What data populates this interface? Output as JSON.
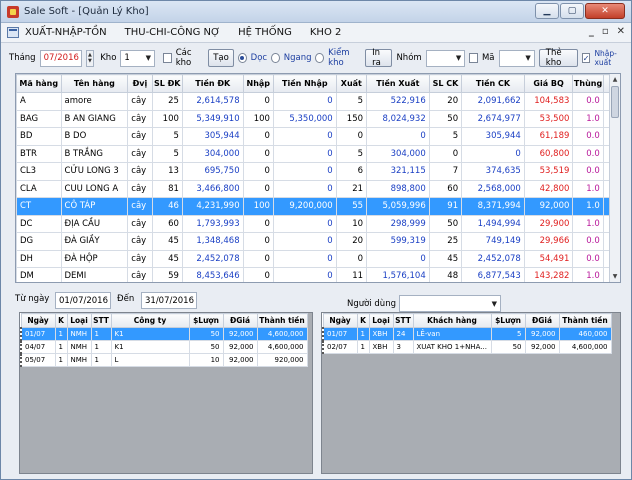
{
  "window": {
    "title": "Sale Soft - [Quản Lý Kho]"
  },
  "menu": [
    "XUẤT-NHẬP-TỒN",
    "THU-CHI-CÔNG NỢ",
    "HỆ THỐNG",
    "KHO 2"
  ],
  "toolbar": {
    "thang_label": "Tháng",
    "thang_value": "07/2016",
    "kho_label": "Kho",
    "kho_value": "1",
    "cac_kho_label": "Các kho",
    "tao_label": "Tạo",
    "doc_label": "Dọc",
    "ngang_label": "Ngang",
    "kiem_kho_label": "Kiểm kho",
    "in_ra_label": "In ra",
    "nhom_label": "Nhóm",
    "nhom_value": "",
    "ma_label": "Mã",
    "ma_value": "",
    "the_kho_label": "Thẻ kho",
    "nhap_xuat_label": "Nhập-xuất",
    "cac_kho_checked": false,
    "ma_checked": false,
    "nhap_xuat_checked": true,
    "view_mode": "Dọc"
  },
  "main_table": {
    "headers": [
      "Mã hàng",
      "Tên hàng",
      "Đvị",
      "SL ĐK",
      "Tiền ĐK",
      "Nhập",
      "Tiền Nhập",
      "Xuất",
      "Tiền Xuất",
      "SL CK",
      "Tiền CK",
      "Giá BQ",
      "Thùng"
    ],
    "selected_row": 6,
    "rows": [
      [
        "A",
        "amore",
        "cây",
        "25",
        "2,614,578",
        "0",
        "0",
        "5",
        "522,916",
        "20",
        "2,091,662",
        "104,583",
        "0.0"
      ],
      [
        "BAG",
        "B AN GIANG",
        "cây",
        "100",
        "5,349,910",
        "100",
        "5,350,000",
        "150",
        "8,024,932",
        "50",
        "2,674,977",
        "53,500",
        "1.0"
      ],
      [
        "BD",
        "B DO",
        "cây",
        "5",
        "305,944",
        "0",
        "0",
        "0",
        "0",
        "5",
        "305,944",
        "61,189",
        "0.0"
      ],
      [
        "BTR",
        "B TRẮNG",
        "cây",
        "5",
        "304,000",
        "0",
        "0",
        "5",
        "304,000",
        "0",
        "0",
        "60,800",
        "0.0"
      ],
      [
        "CL3",
        "CỬU LONG 3",
        "cây",
        "13",
        "695,750",
        "0",
        "0",
        "6",
        "321,115",
        "7",
        "374,635",
        "53,519",
        "0.0"
      ],
      [
        "CLA",
        "CUU LONG A",
        "cây",
        "81",
        "3,466,800",
        "0",
        "0",
        "21",
        "898,800",
        "60",
        "2,568,000",
        "42,800",
        "1.0"
      ],
      [
        "CT",
        "CÔ TÁP",
        "cây",
        "46",
        "4,231,990",
        "100",
        "9,200,000",
        "55",
        "5,059,996",
        "91",
        "8,371,994",
        "92,000",
        "1.0"
      ],
      [
        "DC",
        "ĐỊA CẦU",
        "cây",
        "60",
        "1,793,993",
        "0",
        "0",
        "10",
        "298,999",
        "50",
        "1,494,994",
        "29,900",
        "1.0"
      ],
      [
        "DG",
        "ĐÀ GIẦY",
        "cây",
        "45",
        "1,348,468",
        "0",
        "0",
        "20",
        "599,319",
        "25",
        "749,149",
        "29,966",
        "0.0"
      ],
      [
        "DH",
        "ĐÀ HỘP",
        "cây",
        "45",
        "2,452,078",
        "0",
        "0",
        "0",
        "0",
        "45",
        "2,452,078",
        "54,491",
        "0.0"
      ],
      [
        "DM",
        "DEMI",
        "cây",
        "59",
        "8,453,646",
        "0",
        "0",
        "11",
        "1,576,104",
        "48",
        "6,877,543",
        "143,282",
        "1.0"
      ]
    ]
  },
  "dates": {
    "tu_ngay_label": "Từ ngày",
    "tu_ngay": "01/07/2016",
    "den_label": "Đến",
    "den": "31/07/2016",
    "nguoi_dung_label": "Người dùng",
    "nguoi_dung_value": ""
  },
  "left_table": {
    "headers": [
      "Ngày",
      "K",
      "Loại",
      "STT",
      "Công ty",
      "$Lượn",
      "ĐGiá",
      "Thành tiền"
    ],
    "selected_row": 0,
    "rows": [
      [
        "01/07",
        "1",
        "NMH",
        "1",
        "K1",
        "50",
        "92,000",
        "4,600,000"
      ],
      [
        "04/07",
        "1",
        "NMH",
        "1",
        "K1",
        "50",
        "92,000",
        "4,600,000"
      ],
      [
        "05/07",
        "1",
        "NMH",
        "1",
        "L",
        "10",
        "92,000",
        "920,000"
      ]
    ]
  },
  "right_table": {
    "headers": [
      "Ngày",
      "K",
      "Loại",
      "STT",
      "Khách hàng",
      "$Lượn",
      "ĐGiá",
      "Thành tiền"
    ],
    "selected_row": 0,
    "rows": [
      [
        "01/07",
        "1",
        "XBH",
        "24",
        "LÊ-van",
        "5",
        "92,000",
        "460,000"
      ],
      [
        "02/07",
        "1",
        "XBH",
        "3",
        "XUAT KHO 1+NHA...",
        "50",
        "92,000",
        "4,600,000"
      ]
    ]
  }
}
